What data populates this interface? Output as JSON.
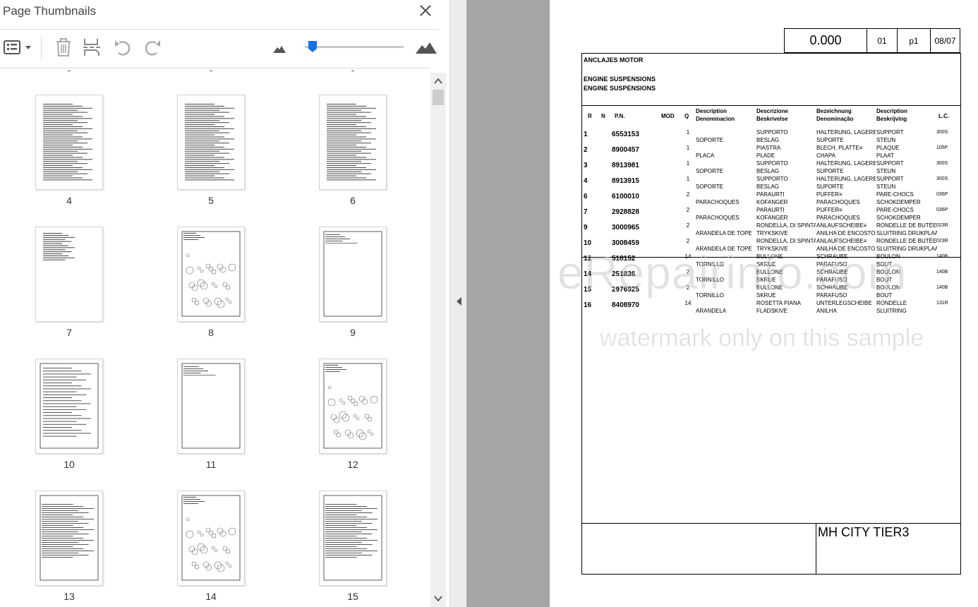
{
  "panel": {
    "title": "Page Thumbnails",
    "close_icon": "close-icon",
    "toolbar": {
      "options_icon": "thumbnail-options-icon",
      "delete_icon": "trash-icon",
      "insert_icon": "insert-pages-icon",
      "undo_icon": "rotate-counterclockwise-icon",
      "redo_icon": "rotate-clockwise-icon",
      "zoom_out_icon": "small-mountain-icon",
      "zoom_in_icon": "large-mountain-icon",
      "zoom_level": 0.04
    },
    "thumbnails": [
      {
        "label": "4",
        "kind": "list"
      },
      {
        "label": "5",
        "kind": "list"
      },
      {
        "label": "6",
        "kind": "list"
      },
      {
        "label": "7",
        "kind": "short-list"
      },
      {
        "label": "8",
        "kind": "drawing"
      },
      {
        "label": "9",
        "kind": "empty-table"
      },
      {
        "label": "10",
        "kind": "text-page"
      },
      {
        "label": "11",
        "kind": "empty-table"
      },
      {
        "label": "12",
        "kind": "drawing"
      },
      {
        "label": "13",
        "kind": "parts-table"
      },
      {
        "label": "14",
        "kind": "drawing"
      },
      {
        "label": "15",
        "kind": "parts-table"
      }
    ]
  },
  "document": {
    "header": {
      "amount": "0.000",
      "code": "01",
      "page": "p1",
      "date": "08/07"
    },
    "section_titles": [
      "ANCLAJES MOTOR",
      "ENGINE SUSPENSIONS",
      "ENGINE SUSPENSIONS"
    ],
    "columns": {
      "r": "R",
      "n": "N",
      "pn": "P.N.",
      "mod": "MOD",
      "q": "Q",
      "desc1": "Description",
      "desc2": "Denominacion",
      "it1": "Descrizione",
      "it2": "Beskrivelse",
      "de1": "Bezeichnung",
      "de2": "Denominação",
      "fr1": "Description",
      "fr2": "Beskrijving",
      "lc": "L.C."
    },
    "rows": [
      {
        "r": "1",
        "pn": "6553153",
        "q": "1",
        "es": "SOPORTE",
        "it1": "SUPPORTO",
        "it2": "BESLAG",
        "de1": "HALTERUNG, LAGERBOCK",
        "de2": "SUPORTE",
        "fr1": "SUPPORT",
        "fr2": "STEUN",
        "lc": "300S"
      },
      {
        "r": "2",
        "pn": "8900457",
        "q": "1",
        "es": "PLACA",
        "it1": "PIASTRA",
        "it2": "PLADE",
        "de1": "BLECH, PLATTE≡",
        "de2": "CHAPA",
        "fr1": "PLAQUE",
        "fr2": "PLAAT",
        "lc": "105P"
      },
      {
        "r": "3",
        "pn": "8913981",
        "q": "1",
        "es": "SOPORTE",
        "it1": "SUPPORTO",
        "it2": "BESLAG",
        "de1": "HALTERUNG, LAGERBOCK",
        "de2": "SUPORTE",
        "fr1": "SUPPORT",
        "fr2": "STEUN",
        "lc": "300S"
      },
      {
        "r": "4",
        "pn": "8913915",
        "q": "1",
        "es": "SOPORTE",
        "it1": "SUPPORTO",
        "it2": "BESLAG",
        "de1": "HALTERUNG, LAGERBOCK",
        "de2": "SUPORTE",
        "fr1": "SUPPORT",
        "fr2": "STEUN",
        "lc": "300S"
      },
      {
        "r": "6",
        "pn": "6100010",
        "q": "2",
        "es": "PARACHOQUES",
        "it1": "PARAURTI",
        "it2": "KOFANGER",
        "de1": "PUFFER≡",
        "de2": "PARACHOQUES",
        "fr1": "PARE-CHOCS",
        "fr2": "SCHOKDEMPER",
        "lc": "036P"
      },
      {
        "r": "7",
        "pn": "2928828",
        "q": "2",
        "es": "PARACHOQUES",
        "it1": "PARAURTI",
        "it2": "KOFANGER",
        "de1": "PUFFER≡",
        "de2": "PARACHOQUES",
        "fr1": "PARE-CHOCS",
        "fr2": "SCHOKDEMPER",
        "lc": "036P"
      },
      {
        "r": "9",
        "pn": "3000965",
        "q": "2",
        "es": "ARANDELA DE TOPE",
        "it1": "RONDELLA, DI SPINTA",
        "it2": "TRYKSKIVE",
        "de1": "ANLAUFSCHEIBE≡",
        "de2": "ANILHA DE ENCOSTO",
        "fr1": "RONDELLE DE BUTÉE",
        "fr2": "SLUITRING DRUKPLAAT",
        "lc": "023R"
      },
      {
        "r": "10",
        "pn": "3008459",
        "q": "2",
        "es": "ARANDELA DE TOPE",
        "it1": "RONDELLA, DI SPINTA",
        "it2": "TRYKSKIVE",
        "de1": "ANLAUFSCHEIBE≡",
        "de2": "ANILHA DE ENCOSTO",
        "fr1": "RONDELLE DE BUTÉE",
        "fr2": "SLUITRING DRUKPLAAT",
        "lc": "023R"
      },
      {
        "r": "12",
        "pn": "518152",
        "q": "14",
        "es": "TORNILLO",
        "it1": "BULLONE",
        "it2": "SKRUE",
        "de1": "SCHRAUBE",
        "de2": "PARAFUSO",
        "fr1": "BOULON",
        "fr2": "BOUT",
        "lc": "140B"
      },
      {
        "r": "14",
        "pn": "251836",
        "q": "2",
        "es": "TORNILLO",
        "it1": "BULLONE",
        "it2": "SKRUE",
        "de1": "SCHRAUBE",
        "de2": "PARAFUSO",
        "fr1": "BOULON",
        "fr2": "BOUT",
        "lc": "140B"
      },
      {
        "r": "15",
        "pn": "2976925",
        "q": "2",
        "es": "TORNILLO",
        "it1": "BULLONE",
        "it2": "SKRUE",
        "de1": "SCHRAUBE",
        "de2": "PARAFUSO",
        "fr1": "BOULON",
        "fr2": "BOUT",
        "lc": "140B"
      },
      {
        "r": "16",
        "pn": "8408970",
        "q": "14",
        "es": "ARANDELA",
        "it1": "ROSETTA PIANA",
        "it2": "FLADSKIVE",
        "de1": "UNTERLEGSCHEIBE",
        "de2": "ANILHA",
        "fr1": "RONDELLE",
        "fr2": "SLUITRING",
        "lc": "131R"
      }
    ],
    "footer": "MH CITY TIER3"
  },
  "watermark": {
    "line1": "eRepairinfo.com",
    "line2": "watermark only on this sample"
  }
}
